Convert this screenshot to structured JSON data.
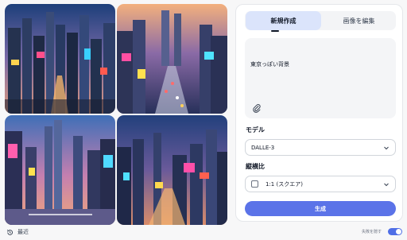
{
  "tabs": {
    "new": "新規作成",
    "edit": "画像を編集"
  },
  "prompt": {
    "value": "東京っぽい背景"
  },
  "model": {
    "label": "モデル",
    "selected": "DALLE-3"
  },
  "ratio": {
    "label": "縦横比",
    "selected": "1:1 (スクエア)"
  },
  "generate_label": "生成",
  "recent_label": "最近",
  "failed_label": "失敗を隠す",
  "images": [
    {
      "alt": "generated-image-1"
    },
    {
      "alt": "generated-image-2"
    },
    {
      "alt": "generated-image-3"
    },
    {
      "alt": "generated-image-4"
    }
  ],
  "colors": {
    "accent": "#5b73e8",
    "tab_active": "#dbe4fb",
    "toggle": "#4f6ee6"
  },
  "toggle_on": true
}
